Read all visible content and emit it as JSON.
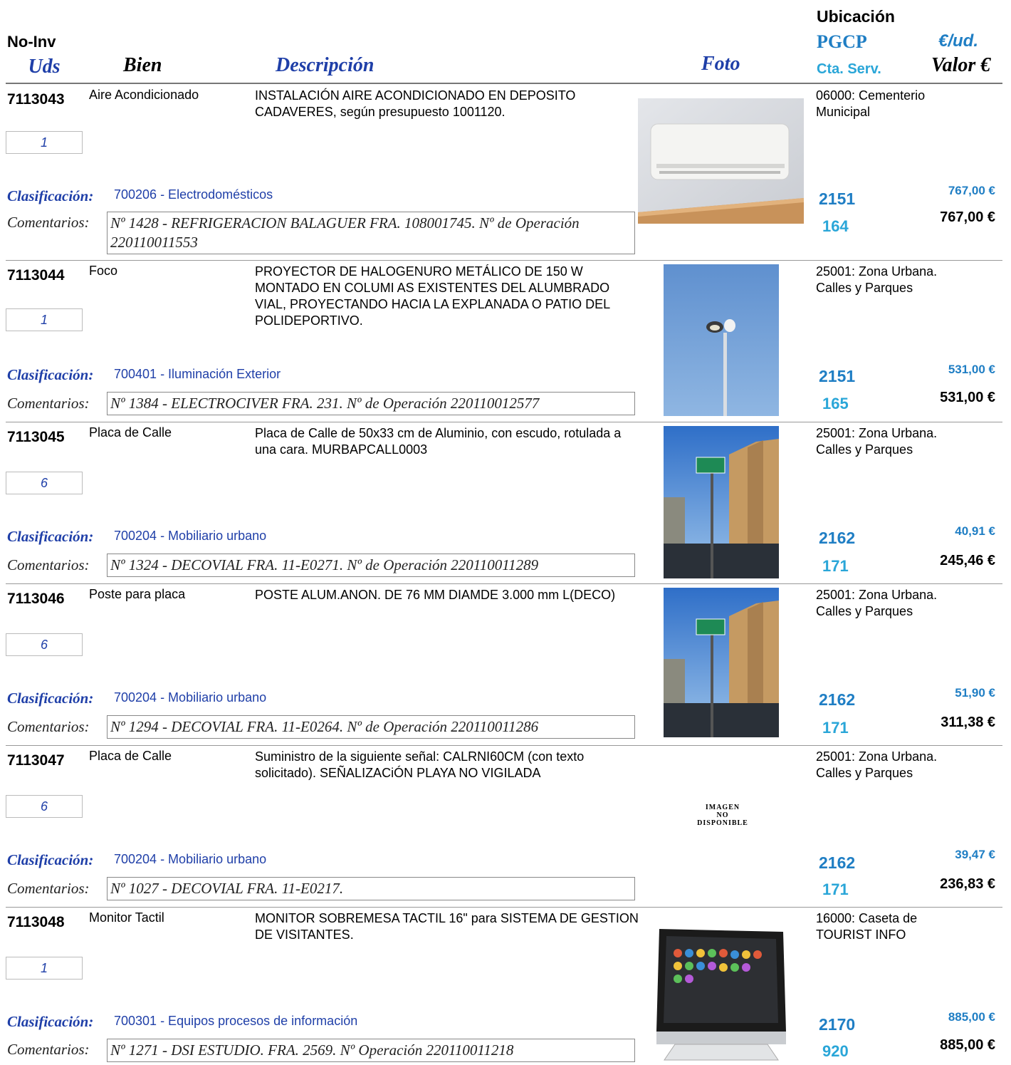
{
  "header": {
    "no_inv": "No-Inv",
    "uds": "Uds",
    "bien": "Bien",
    "descripcion": "Descripción",
    "foto": "Foto",
    "ubicacion": "Ubicación",
    "pgcp": "PGCP",
    "eur_ud": "€/ud.",
    "cta_serv": "Cta. Serv.",
    "valor": "Valor €"
  },
  "labels": {
    "clasificacion": "Clasificación:",
    "comentarios": "Comentarios:"
  },
  "items": [
    {
      "no_inv": "7113043",
      "bien": "Aire Acondicionado",
      "descripcion": "INSTALACIÓN AIRE ACONDICIONADO EN DEPOSITO CADAVERES, según presupuesto 1001120.",
      "uds": "1",
      "clasificacion": "700206 - Electrodomésticos",
      "comentarios": "Nº 1428 - REFRIGERACION BALAGUER FRA. 108001745. Nº de Operación 220110011553",
      "ubicacion": "06000: Cementerio Municipal",
      "pgcp": "2151",
      "cta_serv": "164",
      "eur_ud": "767,00 €",
      "valor": "767,00 €",
      "photo": "air-conditioner-photo"
    },
    {
      "no_inv": "7113044",
      "bien": "Foco",
      "descripcion": "PROYECTOR DE HALOGENURO METÁLICO DE 150 W MONTADO EN COLUMI AS EXISTENTES DEL ALUMBRADO VIAL, PROYECTANDO HACIA LA EXPLANADA O PATIO DEL POLIDEPORTIVO.",
      "uds": "1",
      "clasificacion": "700401 - Iluminación Exterior",
      "comentarios": "Nº 1384 - ELECTROCIVER FRA. 231. Nº de Operación 220110012577",
      "ubicacion": "25001: Zona Urbana. Calles y Parques",
      "pgcp": "2151",
      "cta_serv": "165",
      "eur_ud": "531,00 €",
      "valor": "531,00 €",
      "photo": "street-light-photo"
    },
    {
      "no_inv": "7113045",
      "bien": "Placa de Calle",
      "descripcion": "Placa de Calle de 50x33 cm de Aluminio, con escudo, rotulada a una cara. MURBAPCALL0003",
      "uds": "6",
      "clasificacion": "700204 - Mobiliario urbano",
      "comentarios": "Nº 1324 - DECOVIAL FRA. 11-E0271. Nº de Operación 220110011289",
      "ubicacion": "25001: Zona Urbana. Calles y Parques",
      "pgcp": "2162",
      "cta_serv": "171",
      "eur_ud": "40,91 €",
      "valor": "245,46 €",
      "photo": "street-sign-photo"
    },
    {
      "no_inv": "7113046",
      "bien": "Poste para placa",
      "descripcion": "POSTE ALUM.ANON. DE 76 MM DIAMDE 3.000 mm L(DECO)",
      "uds": "6",
      "clasificacion": "700204 - Mobiliario urbano",
      "comentarios": "Nº 1294 - DECOVIAL FRA. 11-E0264. Nº de Operación 220110011286",
      "ubicacion": "25001: Zona Urbana. Calles y Parques",
      "pgcp": "2162",
      "cta_serv": "171",
      "eur_ud": "51,90 €",
      "valor": "311,38 €",
      "photo": "sign-post-photo"
    },
    {
      "no_inv": "7113047",
      "bien": "Placa de Calle",
      "descripcion": "Suministro de la siguiente señal: CALRNI60CM (con texto solicitado). SEÑALIZACiÓN PLAYA NO VIGILADA",
      "uds": "6",
      "clasificacion": "700204 - Mobiliario urbano",
      "comentarios": "Nº 1027 - DECOVIAL FRA. 11-E0217.",
      "ubicacion": "25001: Zona Urbana. Calles y Parques",
      "pgcp": "2162",
      "cta_serv": "171",
      "eur_ud": "39,47 €",
      "valor": "236,83 €",
      "no_image": [
        "IMAGEN",
        "NO",
        "DISPONIBLE"
      ]
    },
    {
      "no_inv": "7113048",
      "bien": "Monitor Tactil",
      "descripcion": "MONITOR SOBREMESA TACTIL 16\" para SISTEMA DE GESTION DE VISITANTES.",
      "uds": "1",
      "clasificacion": "700301 - Equipos procesos de información",
      "comentarios": "Nº 1271 - DSI ESTUDIO. FRA. 2569.  Nº Operación 220110011218",
      "ubicacion": "16000: Caseta de TOURIST INFO",
      "pgcp": "2170",
      "cta_serv": "920",
      "eur_ud": "885,00 €",
      "valor": "885,00 €",
      "photo": "touch-monitor-photo"
    }
  ]
}
